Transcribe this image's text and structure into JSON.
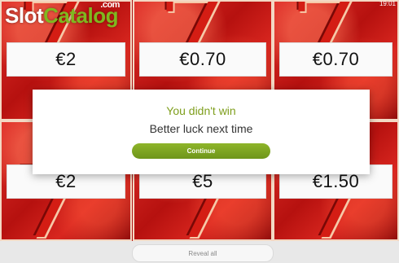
{
  "logo": {
    "part1": "Slot",
    "part2": "Catalog",
    "com": ".com"
  },
  "corner_text": "19:01",
  "tiles": [
    {
      "price": "€2"
    },
    {
      "price": "€0.70"
    },
    {
      "price": "€0.70"
    },
    {
      "price": "€2"
    },
    {
      "price": "€5"
    },
    {
      "price": "€1.50"
    }
  ],
  "modal": {
    "title": "You didn't win",
    "subtitle": "Better luck next time",
    "continue_label": "Continue"
  },
  "footer": {
    "reveal_label": "Reveal all"
  },
  "colors": {
    "accent": "#7e9e1c",
    "background": "#b01515"
  }
}
